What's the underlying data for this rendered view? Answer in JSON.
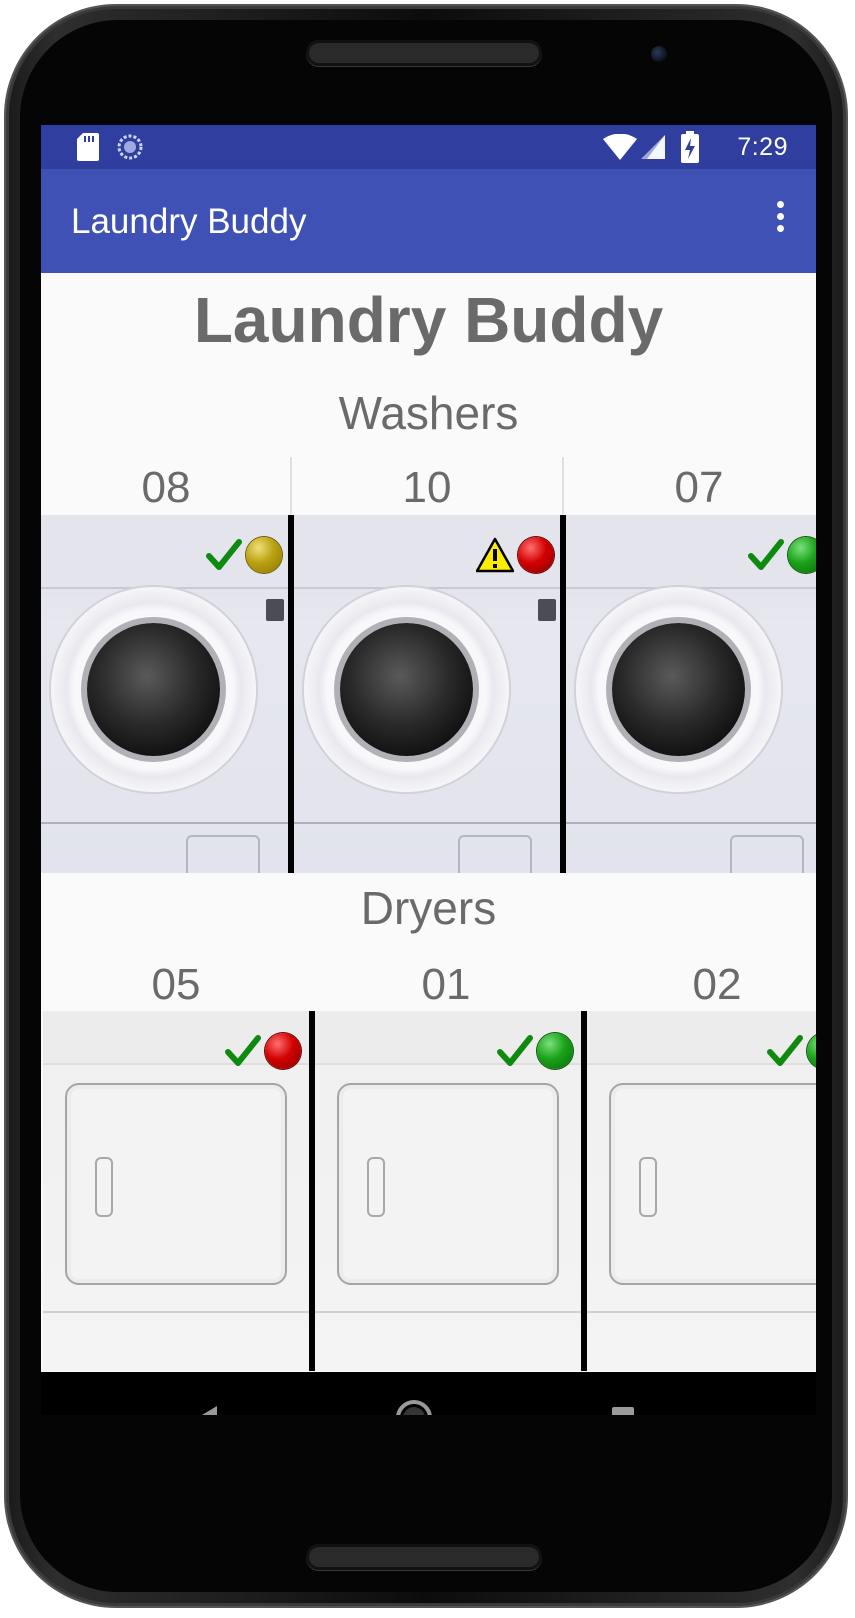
{
  "status_bar": {
    "time": "7:29",
    "icons": [
      "sd-card-icon",
      "sync-icon",
      "wifi-icon",
      "cell-signal-icon",
      "battery-charging-icon"
    ]
  },
  "app_bar": {
    "title": "Laundry Buddy",
    "overflow_icon": "more-vert-icon"
  },
  "main": {
    "heading": "Laundry Buddy",
    "washers": {
      "title": "Washers",
      "machines": [
        {
          "number": "08",
          "check": true,
          "light": "yellow"
        },
        {
          "number": "10",
          "warning": true,
          "light": "red"
        },
        {
          "number": "07",
          "check": true,
          "light": "green"
        }
      ]
    },
    "dryers": {
      "title": "Dryers",
      "machines": [
        {
          "number": "05",
          "check": true,
          "light": "red"
        },
        {
          "number": "01",
          "check": true,
          "light": "green"
        },
        {
          "number": "02",
          "check": true,
          "light": "green"
        }
      ]
    }
  },
  "nav_bar": {
    "icons": [
      "back-icon",
      "home-icon",
      "recents-icon"
    ]
  },
  "colors": {
    "status_bar": "#303f9f",
    "app_bar": "#3f51b5",
    "heading_text": "#6a6a6a",
    "check": "#0e8a0e"
  }
}
